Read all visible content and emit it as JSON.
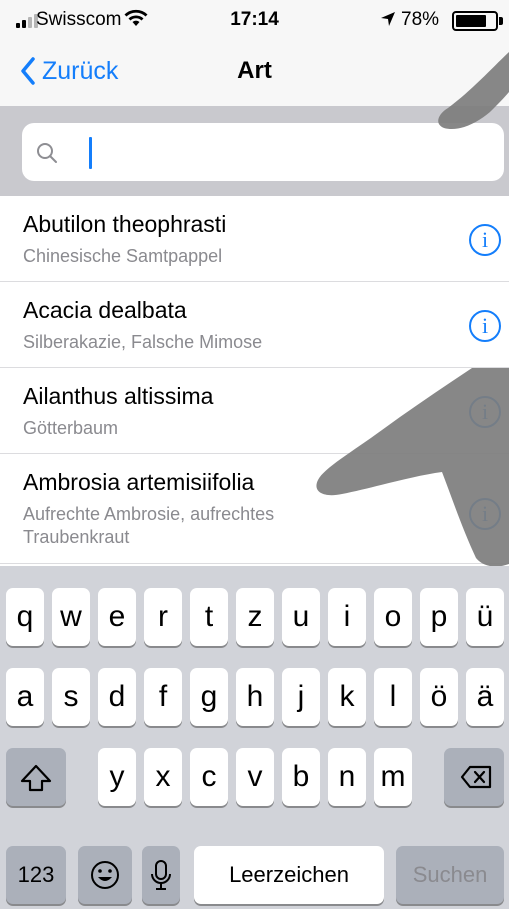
{
  "status_bar": {
    "carrier": "Swisscom",
    "time": "17:14",
    "battery_percent": "78%",
    "battery_level": 0.78,
    "icons": [
      "signal-icon",
      "wifi-icon",
      "location-arrow-icon",
      "battery-icon"
    ]
  },
  "nav": {
    "back_label": "Zurück",
    "title": "Art"
  },
  "search": {
    "value": "",
    "placeholder": ""
  },
  "list": [
    {
      "title": "Abutilon theophrasti",
      "subtitle": "Chinesische Samtpappel",
      "info": "i"
    },
    {
      "title": "Acacia dealbata",
      "subtitle": "Silberakazie, Falsche Mimose",
      "info": "i"
    },
    {
      "title": "Ailanthus altissima",
      "subtitle": "Götterbaum",
      "info": "i"
    },
    {
      "title": "Ambrosia artemisiifolia",
      "subtitle": "Aufrechte Ambrosie, aufrechtes Traubenkraut",
      "info": "i"
    }
  ],
  "keyboard": {
    "row1": [
      "q",
      "w",
      "e",
      "r",
      "t",
      "z",
      "u",
      "i",
      "o",
      "p",
      "ü"
    ],
    "row2": [
      "a",
      "s",
      "d",
      "f",
      "g",
      "h",
      "j",
      "k",
      "l",
      "ö",
      "ä"
    ],
    "row3": [
      "y",
      "x",
      "c",
      "v",
      "b",
      "n",
      "m"
    ],
    "numbers_label": "123",
    "space_label": "Leerzeichen",
    "search_label": "Suchen"
  },
  "colors": {
    "accent": "#147efb",
    "keyboard_bg": "#d1d3d9",
    "search_bg": "#c9c9ce",
    "subtitle": "#8a8a8f"
  }
}
